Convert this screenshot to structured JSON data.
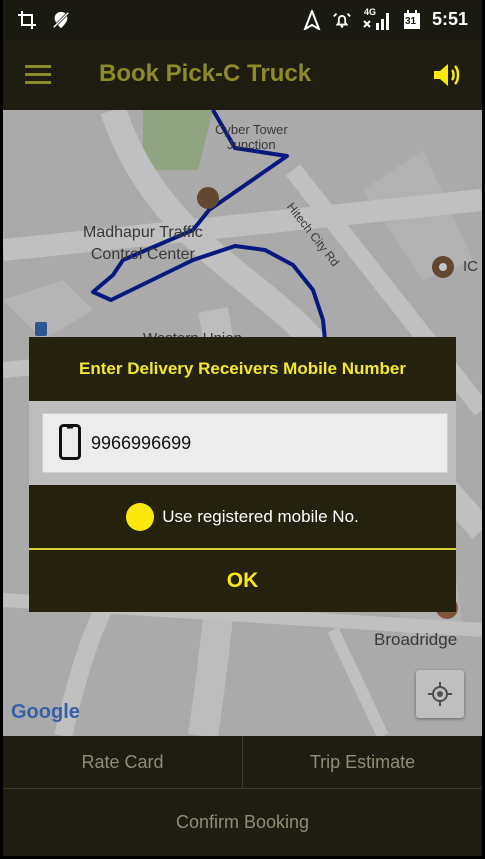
{
  "status_bar": {
    "time": "5:51",
    "network": "4G",
    "calendar_day": "31",
    "icons": [
      "crop-icon",
      "no-location-icon",
      "navigation-icon",
      "alarm-icon",
      "signal-icon",
      "calendar-icon"
    ]
  },
  "app_bar": {
    "title": "Book Pick-C Truck",
    "menu_icon": "hamburger-menu-icon",
    "sound_icon": "volume-icon"
  },
  "map": {
    "labels": {
      "cyber_tower": "Cyber Tower\nJunction",
      "madhapur": "Madhapur Traffic\nControl Center",
      "hitech_city": "Hitech City Rd",
      "western": "Western Union",
      "broadridge": "Broadridge",
      "ic": "IC"
    },
    "google_logo": "Google",
    "my_location_icon": "my-location-icon"
  },
  "dialog": {
    "title": "Enter Delivery Receivers Mobile Number",
    "mobile_value": "9966996699",
    "radio_label": "Use registered mobile No.",
    "ok_label": "OK"
  },
  "bottom": {
    "rate_card": "Rate Card",
    "trip_estimate": "Trip Estimate",
    "confirm_booking": "Confirm Booking"
  },
  "colors": {
    "appbar_bg": "#1f1d12",
    "title_color": "#8d8a2a",
    "accent_yellow": "#fbe90d",
    "route_blue": "#0b1fa3"
  }
}
